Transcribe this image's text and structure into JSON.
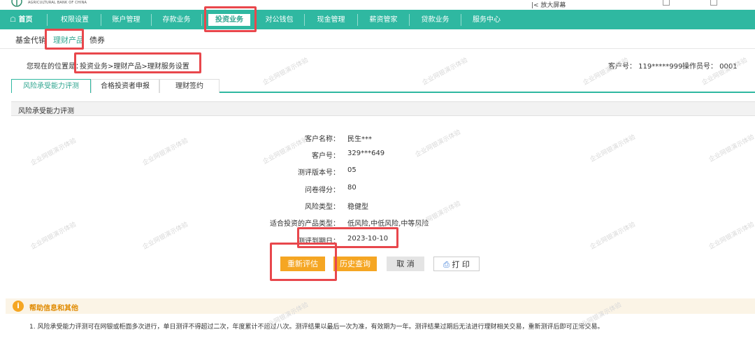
{
  "top": {
    "bank_name_en": "AGRICULTURAL BANK OF CHINA",
    "right_text": "|< 放大屏幕"
  },
  "nav": {
    "home": "首页",
    "items": [
      "权限设置",
      "账户管理",
      "存款业务",
      "投资业务",
      "对公钱包",
      "现金管理",
      "薪资管家",
      "贷款业务",
      "服务中心"
    ]
  },
  "subnav": {
    "items": [
      "基金代销",
      "理财产品",
      "债券"
    ]
  },
  "location": {
    "label": "您现在的位置是：",
    "path": "投资业务>理财产品>理财服务设置",
    "customer_no": "客户号：  119*****999",
    "operator_no": "操作员号：  0001"
  },
  "tabs": [
    "风险承受能力评测",
    "合格投资者申报",
    "理财签约"
  ],
  "section": {
    "title": "风险承受能力评测"
  },
  "fields": [
    {
      "label": "客户名称：",
      "value": "民生***"
    },
    {
      "label": "客户号：",
      "value": "329***649"
    },
    {
      "label": "测评版本号：",
      "value": "05"
    },
    {
      "label": "问卷得分：",
      "value": "80"
    },
    {
      "label": "风险类型：",
      "value": "稳健型"
    },
    {
      "label": "适合投资的产品类型：",
      "value": "低风险,中低风险,中等风险"
    },
    {
      "label": "测评到期日：",
      "value": "2023-10-10"
    }
  ],
  "buttons": {
    "reassess": "重新评估",
    "history": "历史查询",
    "cancel": "取 消",
    "print": "打 印"
  },
  "help": {
    "title": "帮助信息和其他",
    "text": "1. 风险承受能力评测可在网银或柜面多次进行，单日测评不得超过二次，年度累计不超过八次。测评结果以最后一次为准，有效期为一年。测评结果过期后无法进行理财相关交易，重新测评后即可正常交易。"
  },
  "watermark": "企业网银演示体验",
  "colors": {
    "nav_bg": "#2fb8a1",
    "accent": "#2fa58f",
    "button_orange": "#f5a623",
    "highlight": "#e8474c"
  }
}
